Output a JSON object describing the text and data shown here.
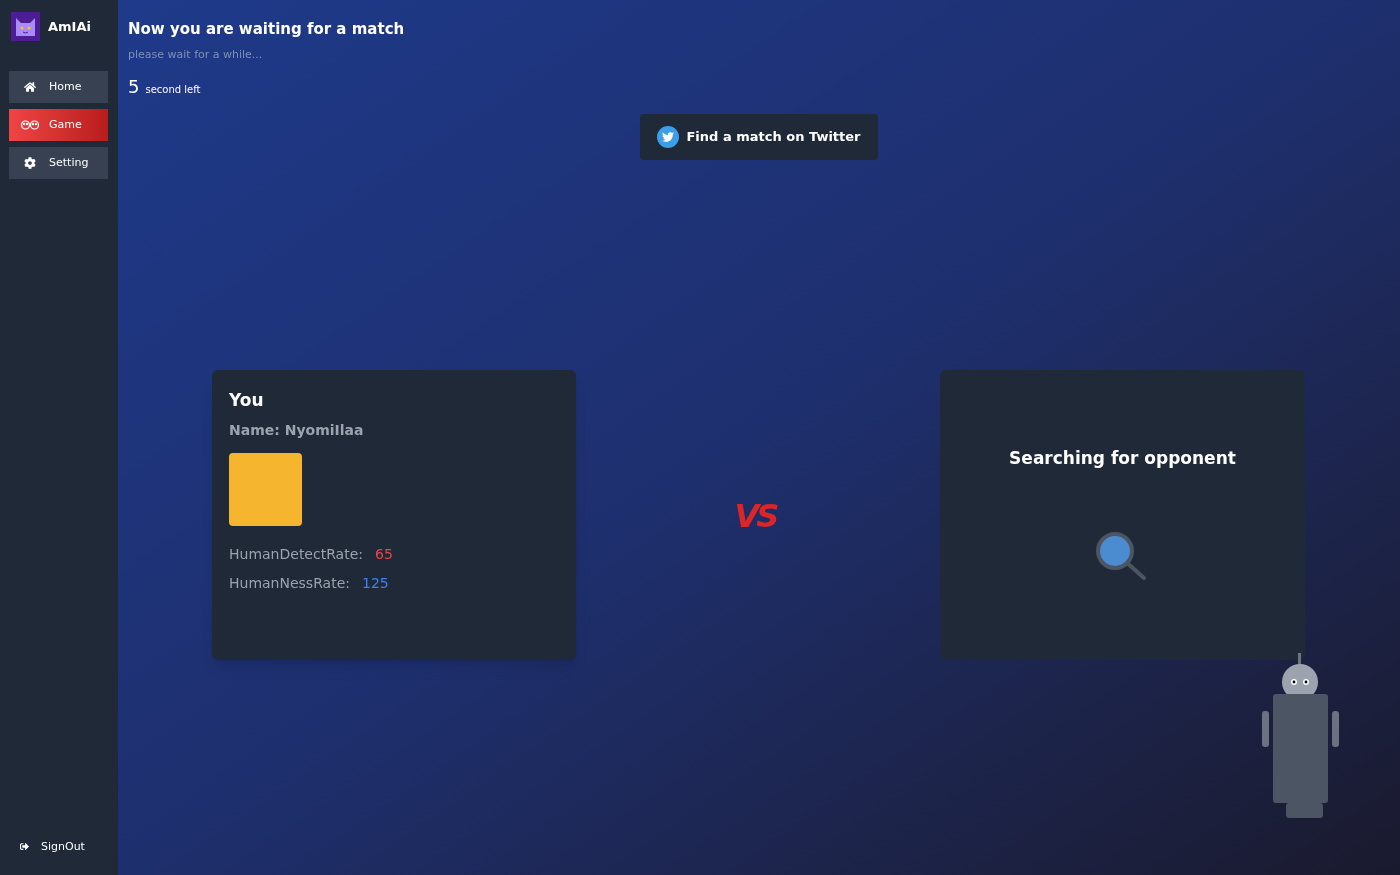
{
  "app": {
    "name": "AmIAi"
  },
  "sidebar": {
    "items": [
      {
        "label": "Home",
        "kind": "home",
        "selected": false
      },
      {
        "label": "Game",
        "kind": "game",
        "selected": true
      },
      {
        "label": "Setting",
        "kind": "settings",
        "selected": false
      }
    ],
    "signout": "SignOut"
  },
  "header": {
    "title": "Now you are waiting for a match",
    "subtitle": "please wait for a while...",
    "countdown": "5",
    "countdown_unit": "second left"
  },
  "twitter_button": "Find a match on Twitter",
  "player_card": {
    "title": "You",
    "name": "Name: NyomiIlaa",
    "stats": [
      {
        "label": "HumanDetectRate:",
        "value": "65",
        "color": "#ef4444"
      },
      {
        "label": "HumanNessRate:",
        "value": "125",
        "color": "#3b82f6"
      }
    ]
  },
  "versus": "VS",
  "opponent_card": {
    "status": "Searching for opponent"
  }
}
